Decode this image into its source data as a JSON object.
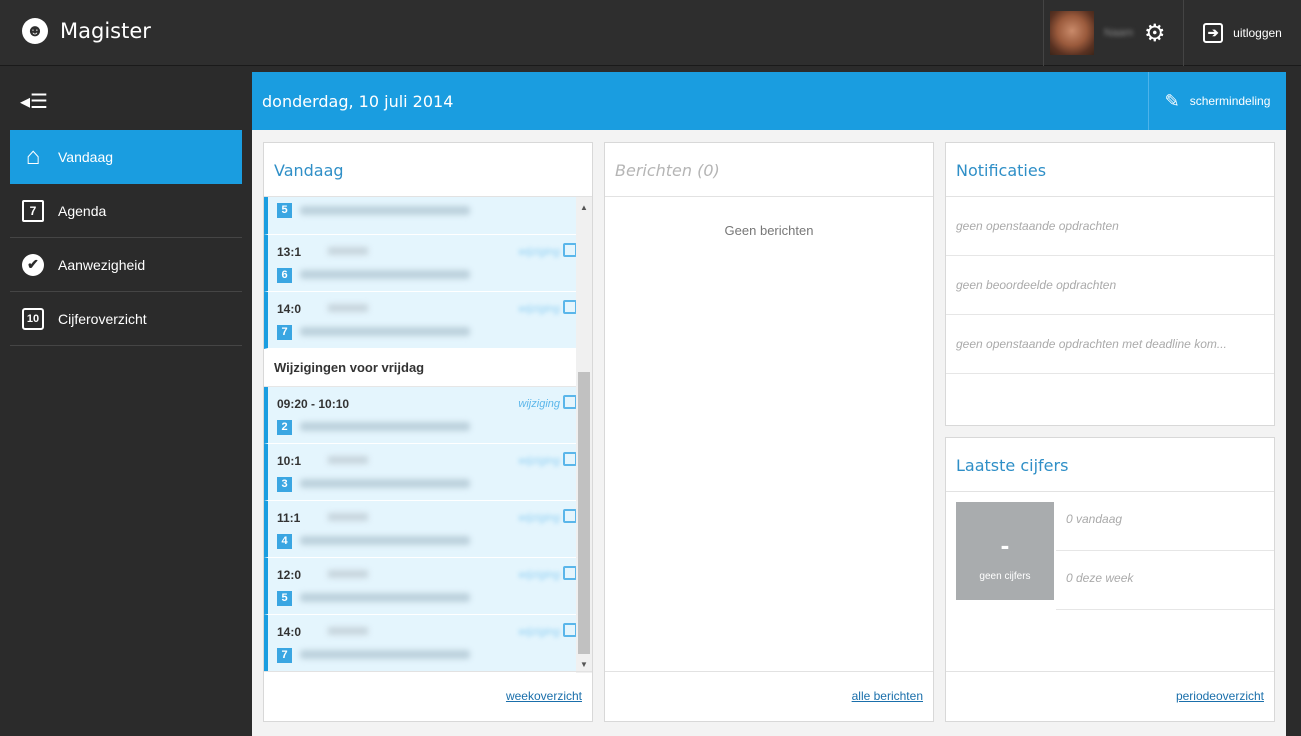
{
  "app": {
    "title": "Magister",
    "logo_icon": "people-icon"
  },
  "topbar": {
    "user_name": "Naam",
    "settings_icon": "gear-icon",
    "logout_label": "uitloggen"
  },
  "sidebar": {
    "collapse_icon": "menu-collapse-icon",
    "items": [
      {
        "label": "Vandaag",
        "icon": "home-icon",
        "active": true
      },
      {
        "label": "Agenda",
        "icon": "calendar-icon",
        "icon_text": "7",
        "active": false
      },
      {
        "label": "Aanwezigheid",
        "icon": "check-icon",
        "icon_text": "✔",
        "active": false
      },
      {
        "label": "Cijferoverzicht",
        "icon": "grade-10-icon",
        "icon_text": "10",
        "active": false
      }
    ]
  },
  "header": {
    "date": "donderdag, 10 juli 2014",
    "layout_label": "schermindeling"
  },
  "vandaag": {
    "title": "Vandaag",
    "today_lessons": [
      {
        "time": "",
        "hour": "5"
      },
      {
        "time": "13:1",
        "hour": "6"
      },
      {
        "time": "14:0",
        "hour": "7"
      }
    ],
    "separator": "Wijzigingen voor vrijdag",
    "friday_lessons": [
      {
        "time": "09:20 - 10:10",
        "hour": "2",
        "change": "wijziging"
      },
      {
        "time": "10:1",
        "hour": "3"
      },
      {
        "time": "11:1",
        "hour": "4"
      },
      {
        "time": "12:0",
        "hour": "5"
      },
      {
        "time": "14:0",
        "hour": "7"
      }
    ],
    "footer_link": "weekoverzicht"
  },
  "berichten": {
    "title": "Berichten (0)",
    "empty": "Geen berichten",
    "footer_link": "alle berichten"
  },
  "notificaties": {
    "title": "Notificaties",
    "items": [
      "geen openstaande opdrachten",
      "geen beoordeelde opdrachten",
      "geen openstaande opdrachten met deadline kom..."
    ]
  },
  "cijfers": {
    "title": "Laatste cijfers",
    "tile_value": "-",
    "tile_label": "geen cijfers",
    "today": "0 vandaag",
    "week": "0 deze week",
    "footer_link": "periodeoverzicht"
  },
  "colors": {
    "accent": "#1a9de0",
    "topbar": "#2e2e2e",
    "lesson_bg": "#e4f5fd"
  }
}
